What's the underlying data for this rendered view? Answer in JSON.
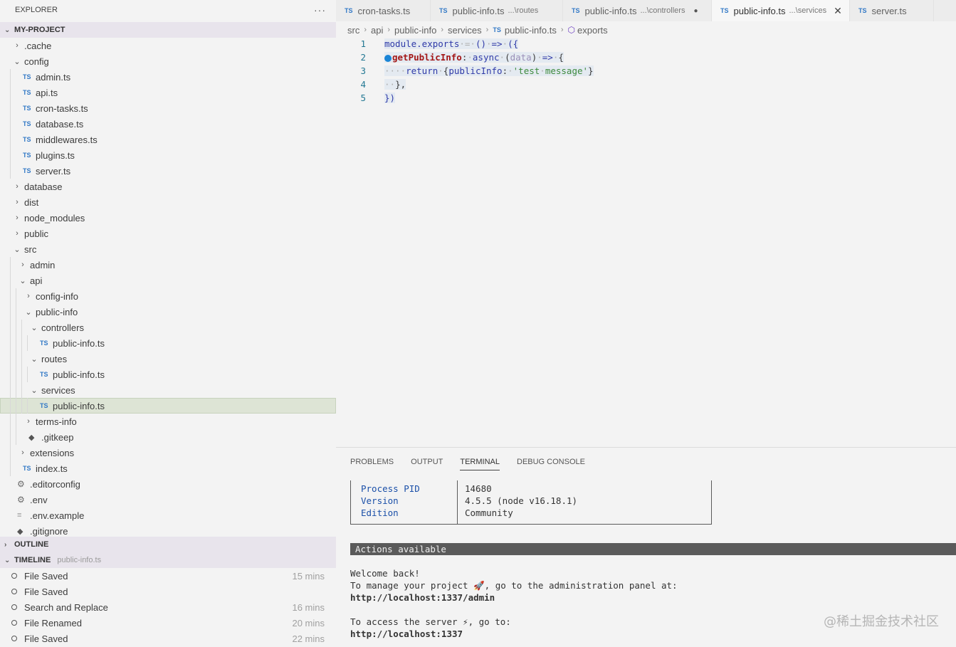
{
  "explorer": {
    "title": "EXPLORER",
    "more_label": "···",
    "project_name": "MY-PROJECT",
    "tree": [
      {
        "label": ".cache",
        "type": "folder",
        "depth": 1,
        "open": false
      },
      {
        "label": "config",
        "type": "folder",
        "depth": 1,
        "open": true
      },
      {
        "label": "admin.ts",
        "type": "ts",
        "depth": 2
      },
      {
        "label": "api.ts",
        "type": "ts",
        "depth": 2
      },
      {
        "label": "cron-tasks.ts",
        "type": "ts",
        "depth": 2
      },
      {
        "label": "database.ts",
        "type": "ts",
        "depth": 2
      },
      {
        "label": "middlewares.ts",
        "type": "ts",
        "depth": 2
      },
      {
        "label": "plugins.ts",
        "type": "ts",
        "depth": 2
      },
      {
        "label": "server.ts",
        "type": "ts",
        "depth": 2
      },
      {
        "label": "database",
        "type": "folder",
        "depth": 1,
        "open": false
      },
      {
        "label": "dist",
        "type": "folder",
        "depth": 1,
        "open": false
      },
      {
        "label": "node_modules",
        "type": "folder",
        "depth": 1,
        "open": false
      },
      {
        "label": "public",
        "type": "folder",
        "depth": 1,
        "open": false
      },
      {
        "label": "src",
        "type": "folder",
        "depth": 1,
        "open": true
      },
      {
        "label": "admin",
        "type": "folder",
        "depth": 2,
        "open": false
      },
      {
        "label": "api",
        "type": "folder",
        "depth": 2,
        "open": true
      },
      {
        "label": "config-info",
        "type": "folder",
        "depth": 3,
        "open": false
      },
      {
        "label": "public-info",
        "type": "folder",
        "depth": 3,
        "open": true
      },
      {
        "label": "controllers",
        "type": "folder",
        "depth": 4,
        "open": true
      },
      {
        "label": "public-info.ts",
        "type": "ts",
        "depth": 5
      },
      {
        "label": "routes",
        "type": "folder",
        "depth": 4,
        "open": true
      },
      {
        "label": "public-info.ts",
        "type": "ts",
        "depth": 5
      },
      {
        "label": "services",
        "type": "folder",
        "depth": 4,
        "open": true
      },
      {
        "label": "public-info.ts",
        "type": "ts",
        "depth": 5,
        "selected": true
      },
      {
        "label": "terms-info",
        "type": "folder",
        "depth": 3,
        "open": false
      },
      {
        "label": ".gitkeep",
        "type": "dot",
        "depth": 3
      },
      {
        "label": "extensions",
        "type": "folder",
        "depth": 2,
        "open": false
      },
      {
        "label": "index.ts",
        "type": "ts",
        "depth": 2
      },
      {
        "label": ".editorconfig",
        "type": "gear",
        "depth": 1
      },
      {
        "label": ".env",
        "type": "gear",
        "depth": 1
      },
      {
        "label": ".env.example",
        "type": "lines",
        "depth": 1
      },
      {
        "label": ".gitignore",
        "type": "dot",
        "depth": 1
      }
    ]
  },
  "outline": {
    "title": "OUTLINE"
  },
  "timeline": {
    "title": "TIMELINE",
    "file": "public-info.ts",
    "items": [
      {
        "label": "File Saved",
        "time": "15 mins"
      },
      {
        "label": "File Saved",
        "time": ""
      },
      {
        "label": "Search and Replace",
        "time": "16 mins"
      },
      {
        "label": "File Renamed",
        "time": "20 mins"
      },
      {
        "label": "File Saved",
        "time": "22 mins"
      }
    ]
  },
  "tabs": [
    {
      "label": "cron-tasks.ts",
      "desc": "",
      "active": false,
      "modified": false
    },
    {
      "label": "public-info.ts",
      "desc": "...\\routes",
      "active": false,
      "modified": false
    },
    {
      "label": "public-info.ts",
      "desc": "...\\controllers",
      "active": false,
      "modified": true
    },
    {
      "label": "public-info.ts",
      "desc": "...\\services",
      "active": true,
      "modified": false
    },
    {
      "label": "server.ts",
      "desc": "",
      "active": false,
      "modified": false
    }
  ],
  "icons": {
    "ts": "TS",
    "modified": "●",
    "close": "✕",
    "folder_closed": "›",
    "folder_open": "⌄"
  },
  "breadcrumb": [
    "src",
    "api",
    "public-info",
    "services",
    "public-info.ts",
    "exports"
  ],
  "code_lines": [
    1,
    2,
    3,
    4,
    5
  ],
  "panel": {
    "tabs": [
      "PROBLEMS",
      "OUTPUT",
      "TERMINAL",
      "DEBUG CONSOLE"
    ],
    "active_tab": "TERMINAL"
  },
  "terminal": {
    "table": [
      {
        "key": "Process PID",
        "value": "14680"
      },
      {
        "key": "Version",
        "value": "4.5.5 (node v16.18.1)"
      },
      {
        "key": "Edition",
        "value": "Community"
      }
    ],
    "actions_label": "Actions available",
    "welcome": "Welcome back!",
    "manage_line": "To manage your project 🚀, go to the administration panel at:",
    "admin_url": "http://localhost:1337/admin",
    "server_line": "To access the server ⚡, go to:",
    "server_url": "http://localhost:1337"
  },
  "watermark": "@稀土掘金技术社区",
  "colors": {
    "ts_blue": "#3178c6",
    "selected_bg": "#dde4d5",
    "line_number": "#237893",
    "keyword_blue": "#2f3aa8",
    "string_green": "#3d8a3d"
  }
}
